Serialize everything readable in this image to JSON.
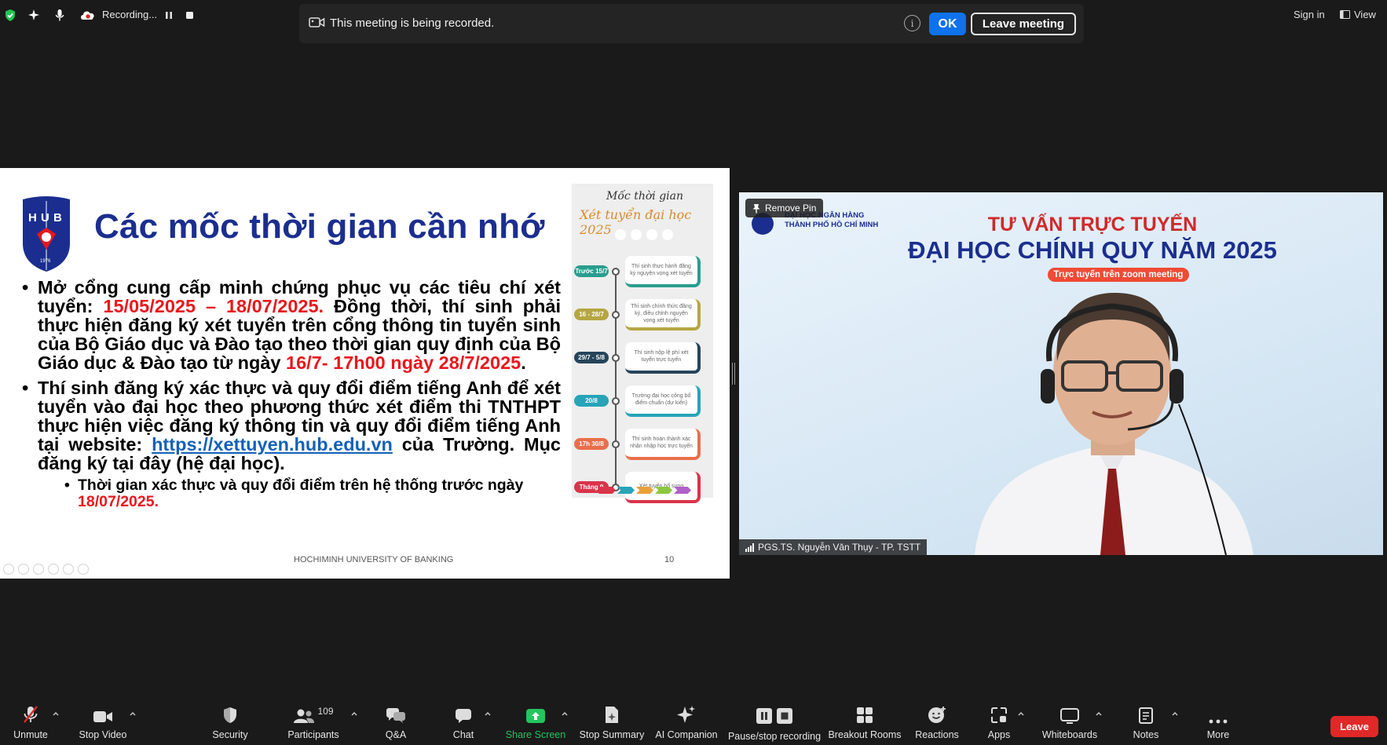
{
  "topbar": {
    "recording_text": "Recording...",
    "sign_in": "Sign in",
    "view": "View"
  },
  "banner": {
    "message": "This meeting is being recorded.",
    "ok": "OK",
    "leave_meeting": "Leave meeting"
  },
  "slide": {
    "logo_text": "HUB",
    "logo_year": "1976",
    "title": "Các mốc thời gian cần nhớ",
    "b1_part1": "Mở cổng cung cấp minh chứng phục vụ các tiêu chí xét tuyển: ",
    "b1_red1": "15/05/2025 – 18/07/2025.",
    "b1_part2": " Đồng thời, thí sinh phải thực hiện đăng ký xét tuyển trên cổng thông tin tuyển sinh của Bộ Giáo dục và Đào tạo theo thời gian quy định của Bộ Giáo dục & Đào tạo từ ngày ",
    "b1_red2": "16/7- 17h00 ngày 28/7/2025",
    "b1_end": ".",
    "b2_part1": "Thí sinh đăng ký xác thực và quy đổi điểm tiếng Anh để xét tuyển vào đại học theo phương thức xét điểm thi TNTHPT thực hiện việc đăng ký thông tin và quy đổi điểm tiếng Anh tại website: ",
    "b2_link": "https://xettuyen.hub.edu.vn",
    "b2_part2": " của Trường. Mục đăng ký tại đây (hệ đại học).",
    "sub_part1": "Thời gian xác thực và quy đổi điểm trên hệ thống trước ngày ",
    "sub_red": "18/07/2025.",
    "footer": "HOCHIMINH UNIVERSITY OF BANKING",
    "page": "10",
    "infographic": {
      "title1": "Mốc thời gian",
      "title2": "Xét tuyển đại học 2025",
      "rows": [
        {
          "tag": "Trước 15/7",
          "text": "Thí sinh thực hành đăng ký nguyện vọng xét tuyển",
          "color": "#2a9d8f"
        },
        {
          "tag": "16 - 28/7",
          "text": "Thí sinh chính thức đăng ký, điều chỉnh nguyện vọng xét tuyển",
          "color": "#b5a642"
        },
        {
          "tag": "29/7 - 5/8",
          "text": "Thí sinh nộp lệ phí xét tuyển trực tuyến",
          "color": "#26455a"
        },
        {
          "tag": "20/8",
          "text": "Trường đại học công bố điểm chuẩn (dự kiến)",
          "color": "#27a4b8"
        },
        {
          "tag": "17h 30/8",
          "text": "Thí sinh hoàn thành xác nhận nhập học trực tuyến",
          "color": "#e86f4b"
        },
        {
          "tag": "Tháng 9",
          "text": "Xét tuyển bổ sung",
          "color": "#d9344a"
        }
      ]
    }
  },
  "video": {
    "remove_pin": "Remove Pin",
    "org_line1": "ĐẠI HỌC NGÂN HÀNG",
    "org_line2": "THÀNH PHỐ HỒ CHÍ MINH",
    "title1": "TƯ VẤN TRỰC TUYẾN",
    "title2": "ĐẠI HỌC CHÍNH QUY NĂM 2025",
    "pill": "Trực tuyến trên zoom meeting",
    "participant_name": "PGS.TS. Nguyễn Văn Thụy - TP. TSTT"
  },
  "toolbar": {
    "unmute": "Unmute",
    "stop_video": "Stop Video",
    "security": "Security",
    "participants": "Participants",
    "participants_count": "109",
    "qa": "Q&A",
    "chat": "Chat",
    "share_screen": "Share Screen",
    "stop_summary": "Stop Summary",
    "ai_companion": "AI Companion",
    "pause_stop_recording": "Pause/stop recording",
    "breakout_rooms": "Breakout Rooms",
    "reactions": "Reactions",
    "apps": "Apps",
    "whiteboards": "Whiteboards",
    "notes": "Notes",
    "more": "More",
    "leave": "Leave"
  },
  "colors": {
    "accent_blue": "#0e72ed",
    "leave_red": "#e02828",
    "share_green": "#22c55e",
    "slide_title_blue": "#1b2e8f",
    "slide_red": "#e8171c"
  }
}
